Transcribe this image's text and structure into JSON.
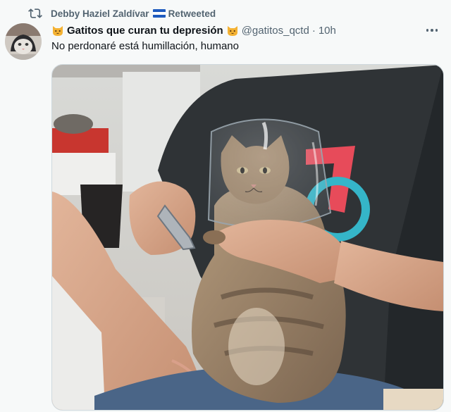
{
  "retweet": {
    "icon": "retweet-icon",
    "user_name": "Debby Haziel Zaldívar",
    "flag": "honduras-flag",
    "label": "Retweeted"
  },
  "tweet": {
    "avatar": "cat-avatar",
    "display_name": "Gatitos que curan tu depresión",
    "handle": "@gatitos_qctd",
    "separator": "·",
    "time": "10h",
    "text": "No perdonaré está humillación, humano",
    "more_icon": "more-horizontal-icon",
    "media": "photo-cat-wearing-glass-while-nails-clipped"
  },
  "colors": {
    "text_primary": "#0f1419",
    "text_secondary": "#536471",
    "background": "#f7f9f9",
    "border": "#cfd9de"
  }
}
